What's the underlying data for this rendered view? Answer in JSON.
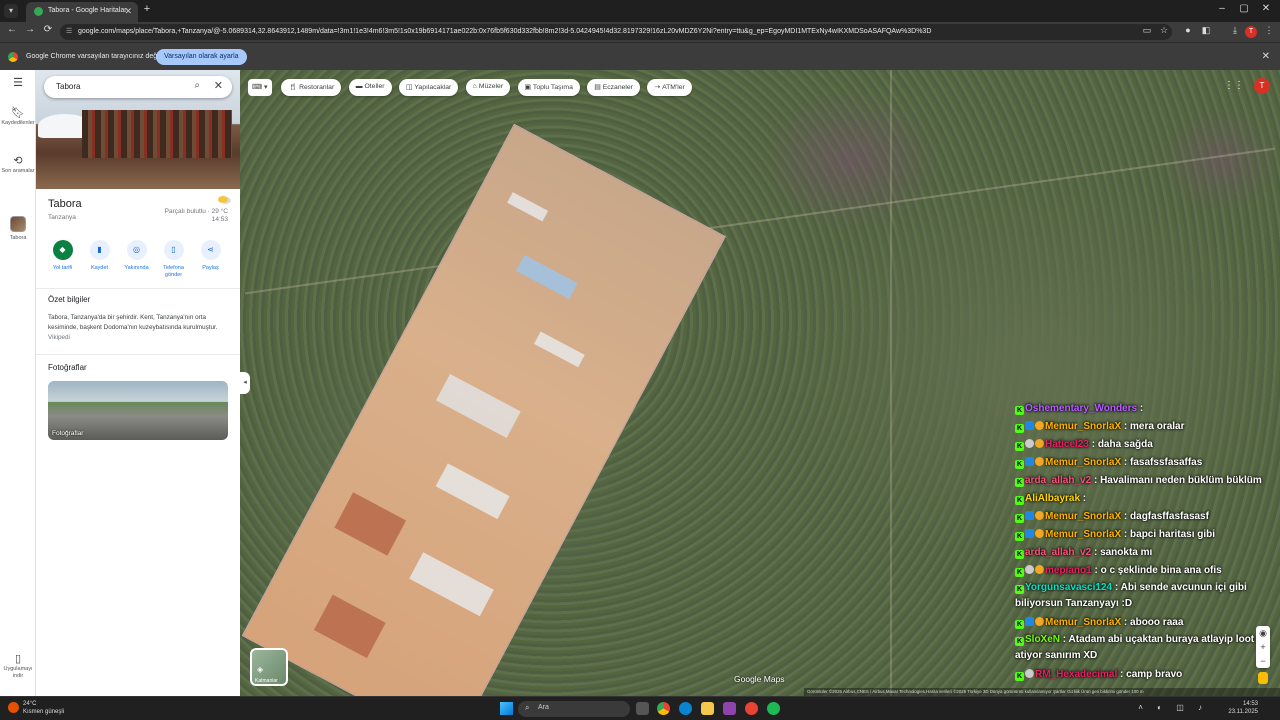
{
  "browser": {
    "tab_title": "Tabora - Google Haritalar",
    "url": "google.com/maps/place/Tabora,+Tanzanya/@-5.0689314,32.8643912,1489m/data=!3m1!1e3!4m6!3m5!1s0x19b6914171ae022b:0x76fb5f630d332fbb!8m2!3d-5.0424945!4d32.8197329!16zL20vMDZ6Y2Ni?entry=ttu&g_ep=EgoyMDI1MTExNy4wIKXMDSoASAFQAw%3D%3D",
    "profile_initial": "T",
    "infobar_message": "Google Chrome varsayılan tarayıcınız değil",
    "infobar_button": "Varsayılan olarak ayarla"
  },
  "rail": {
    "saved_label": "Kaydedilenler",
    "recent_label": "Son aramalar",
    "tabora_label": "Tabora",
    "app_label": "Uygulamayı indir"
  },
  "panel": {
    "search_value": "Tabora",
    "place_title": "Tabora",
    "place_country": "Tanzanya",
    "weather_desc": "Parçalı bulutlu",
    "weather_temp": "29 °C",
    "weather_time": "14:53",
    "actions": [
      {
        "label": "Yol tarifi",
        "icon": "directions-icon"
      },
      {
        "label": "Kaydet",
        "icon": "bookmark-icon"
      },
      {
        "label": "Yakınında",
        "icon": "nearby-icon"
      },
      {
        "label": "Telefona gönder",
        "icon": "send-to-phone-icon"
      },
      {
        "label": "Paylaş",
        "icon": "share-icon"
      }
    ],
    "summary_heading": "Özet bilgiler",
    "summary_text": "Tabora, Tanzanya'da bir şehirdir. Kent, Tanzanya'nın orta kesiminde, başkent Dodoma'nın kuzeybatısında kurulmuştur.",
    "summary_source": "Vikipedi",
    "photos_heading": "Fotoğraflar",
    "photo_label": "Fotoğraflar"
  },
  "map": {
    "chips": [
      "Restoranlar",
      "Oteller",
      "Yapılacaklar",
      "Müzeler",
      "Toplu Taşıma",
      "Eczaneler",
      "ATM'ler"
    ],
    "layers_label": "Katmanlar",
    "logo_text": "Google Maps",
    "attribution": "Görüntüler ©2025 Airbus,CNES / Airbus,Maxar Technologies,Harita verileri ©2025   Türkiye   3D Dünya görünümü kullanılamıyor   Şartlar   Gizlilik   Ürün geri bildirimi gönder   100 m"
  },
  "chat": [
    {
      "user": "Oshementary_Wonders",
      "color": "#b45cff",
      "badges": [
        "k"
      ],
      "text": ""
    },
    {
      "user": "Memur_SnorlaX",
      "color": "#ffb300",
      "badges": [
        "k",
        "s",
        "n"
      ],
      "text": "mera oralar"
    },
    {
      "user": "Haticel23",
      "color": "#e91e63",
      "badges": [
        "k",
        "c",
        "n"
      ],
      "text": "daha sağda"
    },
    {
      "user": "Memur_SnorlaX",
      "color": "#ffb300",
      "badges": [
        "k",
        "s",
        "n"
      ],
      "text": "fasafssfasaffas"
    },
    {
      "user": "arda_allah_v2",
      "color": "#ff4d7a",
      "badges": [
        "k"
      ],
      "text": "Havalimanı neden büklüm büklüm"
    },
    {
      "user": "AliAlbayrak",
      "color": "#ffd600",
      "badges": [
        "k"
      ],
      "text": ""
    },
    {
      "user": "Memur_SnorlaX",
      "color": "#ffb300",
      "badges": [
        "k",
        "s",
        "n"
      ],
      "text": "dagfasffasfasasf"
    },
    {
      "user": "Memur_SnorlaX",
      "color": "#ffb300",
      "badges": [
        "k",
        "s",
        "n"
      ],
      "text": "bapci haritası gibi"
    },
    {
      "user": "arda_allah_v2",
      "color": "#ff4d7a",
      "badges": [
        "k"
      ],
      "text": "sanokta mı"
    },
    {
      "user": "mepiano1",
      "color": "#e91e63",
      "badges": [
        "k",
        "c",
        "n"
      ],
      "text": "o c şeklinde bina ana ofis"
    },
    {
      "user": "Yorgunsavasci124",
      "color": "#00e5c8",
      "badges": [
        "k"
      ],
      "text": "Abi sende avcunun içi gibi biliyorsun Tanzanyayı :D"
    },
    {
      "user": "Memur_SnorlaX",
      "color": "#ffb300",
      "badges": [
        "k",
        "s",
        "n"
      ],
      "text": "abooo raaa"
    },
    {
      "user": "SloXeN",
      "color": "#76ff03",
      "badges": [
        "k"
      ],
      "text": "Atadam abi uçaktan buraya atlayip loot atiyor sanırım XD"
    },
    {
      "user": "RM_Hexadecimal",
      "color": "#e91e63",
      "badges": [
        "k",
        "c"
      ],
      "text": "camp bravo"
    }
  ],
  "taskbar": {
    "weather_temp": "24°C",
    "weather_desc": "Kısmen güneşli",
    "search_placeholder": "Ara",
    "time": "14:53",
    "date": "23.11.2025"
  }
}
